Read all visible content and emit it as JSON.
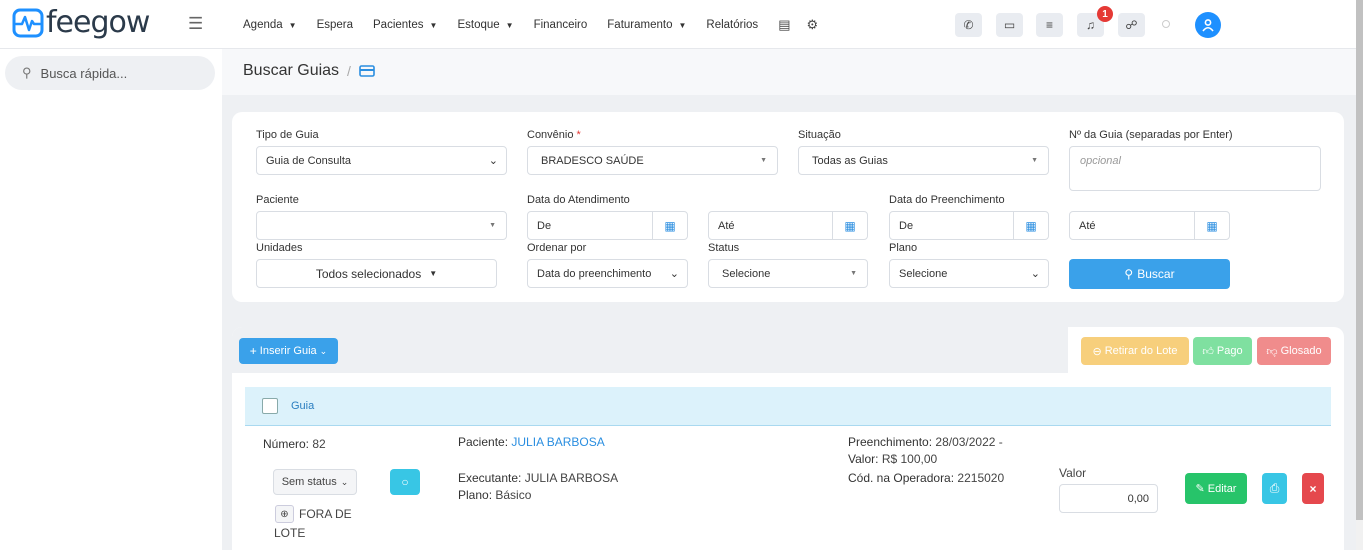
{
  "app": {
    "logo_text": "feegow"
  },
  "nav": {
    "items": [
      {
        "label": "Agenda",
        "dropdown": true
      },
      {
        "label": "Espera",
        "dropdown": false
      },
      {
        "label": "Pacientes",
        "dropdown": true
      },
      {
        "label": "Estoque",
        "dropdown": true
      },
      {
        "label": "Financeiro",
        "dropdown": false
      },
      {
        "label": "Faturamento",
        "dropdown": true
      },
      {
        "label": "Relatórios",
        "dropdown": false
      }
    ],
    "notification_count": "1"
  },
  "sidebar": {
    "search_placeholder": "Busca rápida..."
  },
  "page": {
    "title": "Buscar Guias",
    "separator": "/"
  },
  "filters": {
    "tipo_guia": {
      "label": "Tipo de Guia",
      "value": "Guia de Consulta"
    },
    "convenio": {
      "label": "Convênio",
      "required_mark": "*",
      "value": "BRADESCO SAÚDE"
    },
    "situacao": {
      "label": "Situação",
      "value": "Todas as Guias"
    },
    "num_guia": {
      "label": "Nº da Guia (separadas por Enter)",
      "placeholder": "opcional"
    },
    "paciente": {
      "label": "Paciente",
      "value": ""
    },
    "data_atendimento": {
      "label": "Data do Atendimento",
      "de": "De",
      "ate": "Até"
    },
    "data_preenchimento": {
      "label": "Data do Preenchimento",
      "de": "De",
      "ate": "Até"
    },
    "unidades": {
      "label": "Unidades",
      "value": "Todos selecionados"
    },
    "ordenar_por": {
      "label": "Ordenar por",
      "value": "Data do preenchimento"
    },
    "status": {
      "label": "Status",
      "value": "Selecione"
    },
    "plano": {
      "label": "Plano",
      "value": "Selecione"
    },
    "buscar_label": "Buscar"
  },
  "actions": {
    "inserir_guia": "Inserir Guia",
    "retirar_lote": "Retirar do Lote",
    "pago": "Pago",
    "glosado": "Glosado"
  },
  "results": {
    "header_label": "Guia",
    "rows": [
      {
        "numero_label": "Número:",
        "numero": "82",
        "paciente_label": "Paciente:",
        "paciente": "JULIA BARBOSA",
        "executante_label": "Executante:",
        "executante": "JULIA BARBOSA",
        "plano_label": "Plano:",
        "plano": "Básico",
        "preenchimento_label": "Preenchimento:",
        "preenchimento": "28/03/2022 -",
        "valor_label": "Valor:",
        "valor": "R$ 100,00",
        "cod_operadora_label": "Cód. na Operadora:",
        "cod_operadora": "2215020",
        "status_button": "Sem status",
        "lote_line1": "FORA DE",
        "lote_line2": "LOTE",
        "valor_input_label": "Valor",
        "valor_input": "0,00",
        "editar_label": "Editar"
      }
    ]
  },
  "colors": {
    "brand": "#1e90ff",
    "buscar": "#3aa1ea",
    "retirar_lote": "#f7cf7c",
    "pago": "#7fe0a0",
    "glosado": "#f08c8c",
    "editar": "#27c46a",
    "delete": "#e5484d"
  }
}
